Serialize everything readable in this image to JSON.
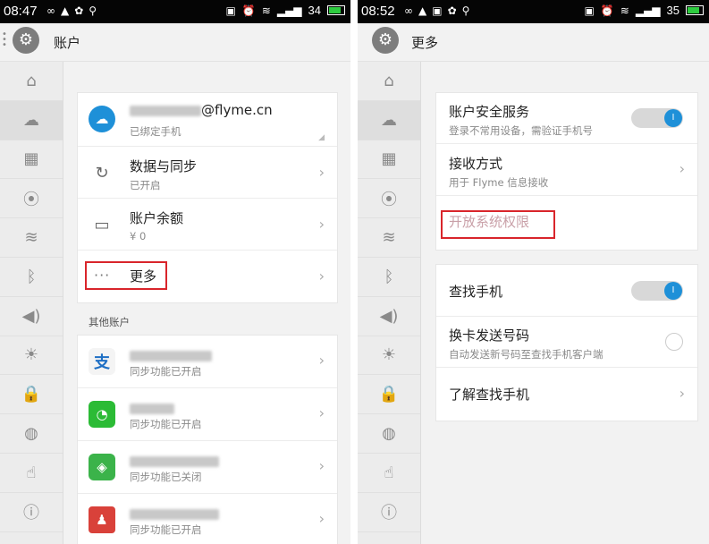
{
  "left": {
    "status": {
      "time": "08:47",
      "battery": "34"
    },
    "title": "账户",
    "account": {
      "email": "@flyme.cn",
      "subtitle": "已绑定手机"
    },
    "items": [
      {
        "title": "数据与同步",
        "subtitle": "已开启"
      },
      {
        "title": "账户余额",
        "subtitle": "¥ 0"
      },
      {
        "title": "更多"
      }
    ],
    "section_label": "其他账户",
    "other_accounts": [
      {
        "icon": "alipay-icon",
        "subtitle": "同步功能已开启"
      },
      {
        "icon": "wechat-icon",
        "subtitle": "同步功能已开启"
      },
      {
        "icon": "app-icon",
        "subtitle": "同步功能已关闭"
      },
      {
        "icon": "contacts-icon",
        "subtitle": "同步功能已开启"
      }
    ],
    "more_dots": "···"
  },
  "right": {
    "status": {
      "time": "08:52",
      "battery": "35"
    },
    "title": "更多",
    "group1": [
      {
        "title": "账户安全服务",
        "subtitle": "登录不常用设备，需验证手机号",
        "toggle": true
      },
      {
        "title": "接收方式",
        "subtitle": "用于 Flyme 信息接收"
      },
      {
        "title": "开放系统权限"
      }
    ],
    "group2": [
      {
        "title": "查找手机",
        "toggle": true
      },
      {
        "title": "换卡发送号码",
        "subtitle": "自动发送新号码至查找手机客户端",
        "radio": false
      },
      {
        "title": "了解查找手机"
      }
    ]
  },
  "rail_icons": [
    "home-icon",
    "cloud-icon",
    "grid-icon",
    "antenna-icon",
    "wifi-icon",
    "bluetooth-icon",
    "volume-icon",
    "brightness-icon",
    "lock-location-icon",
    "globe-icon",
    "hand-icon",
    "info-icon"
  ],
  "colors": {
    "accent": "#1e90d8",
    "highlight_box": "#d9252b",
    "disabled_text": "#c9a0a8"
  }
}
